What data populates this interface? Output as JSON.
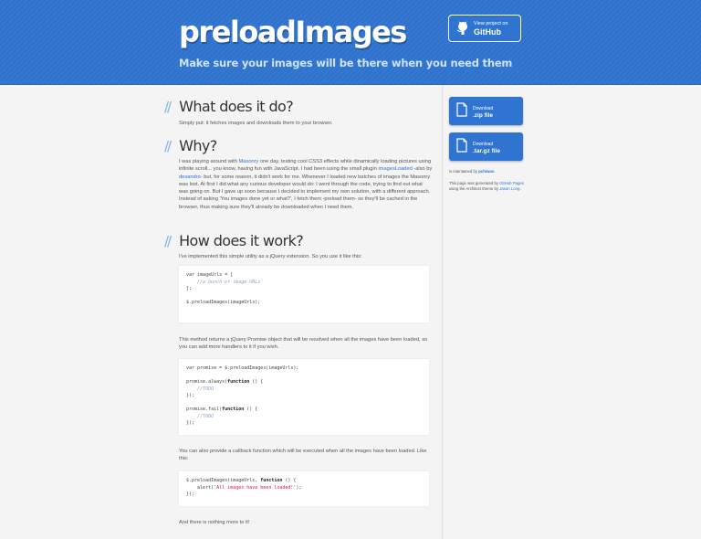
{
  "header": {
    "title": "preloadImages",
    "tagline": "Make sure your images will be there when you need them",
    "github_small": "View project on",
    "github_big": "GitHub"
  },
  "sections": [
    {
      "heading": "What does it do?",
      "slash": "//"
    },
    {
      "heading": "Why?",
      "slash": "//"
    },
    {
      "heading": "How does it work?",
      "slash": "//"
    }
  ],
  "what_text": "Simply put: it fetches images and downloads them to your browser.",
  "why": {
    "t1": "I was playing around with ",
    "link1": "Masonry",
    "t2": " one day, testing cool CSS3 effects while dinamically loading pictures using infinite scroll... you know, having fun with JavaScript. I had been using the small plugin ",
    "link2": "imagesLoaded",
    "t3": " -also by ",
    "link3": "desandro",
    "t4": "- but, for some reason, it didn't work for me. Whenever I loaded new batches of images the Masonry was lost. At first I did what any curious developer would do: I went through the code, trying to find out what was going on. But I gave up soon because I decided to implement my own solution, with a different approach. Instead of asking 'You images done yet or what?', I fetch them -preload them- so they'll be cached in the browser, thus making sure they'll already be downloaded when I need them."
  },
  "how_intro": "I've implemented this simple utility as a jQuery extension. So you use it like this:",
  "code1": {
    "l1": "var imageUrls = [",
    "l2": "    //a bunch of image URLs",
    "l3": "];",
    "l4": "$.preloadImages(imageUrls);"
  },
  "promise_text": "This method returns a jQuery Promise object that will be resolved when all the images have been loaded, so you can add more handlers to it if you wish.",
  "code2": {
    "l1": "var promise = $.preloadImages(imageUrls);",
    "l2a": "promise.always(",
    "kw": "function",
    "l2b": " () {",
    "todo": "    //TODO",
    "close": "});",
    "l3a": "promise.fail("
  },
  "callback_text": "You can also provide a callback function which will be executed when all the images have been loaded. Like this:",
  "code3": {
    "l1a": "$.preloadImages(imageUrls, ",
    "kw": "function",
    "l1b": " () {",
    "l2a": "    alert(",
    "str": "'All images have been loaded!'",
    "l2b": ");",
    "close": "});"
  },
  "final_text": "And there is nothing more to it!",
  "sidebar": {
    "zip_small": "Download",
    "zip_big": ".zip file",
    "tar_small": "Download",
    "tar_big": ".tar.gz file",
    "maintained_prefix": "is maintained by ",
    "maintainer": "pchiwan",
    "generated_prefix": "This page was generated by ",
    "gh_pages": "GitHub Pages",
    "generated_mid": " using the Architect theme by ",
    "theme_author": "Jason Long",
    "generated_end": "."
  },
  "colors": {
    "accent": "#2f74d0",
    "slash": "#7cb3e8"
  }
}
